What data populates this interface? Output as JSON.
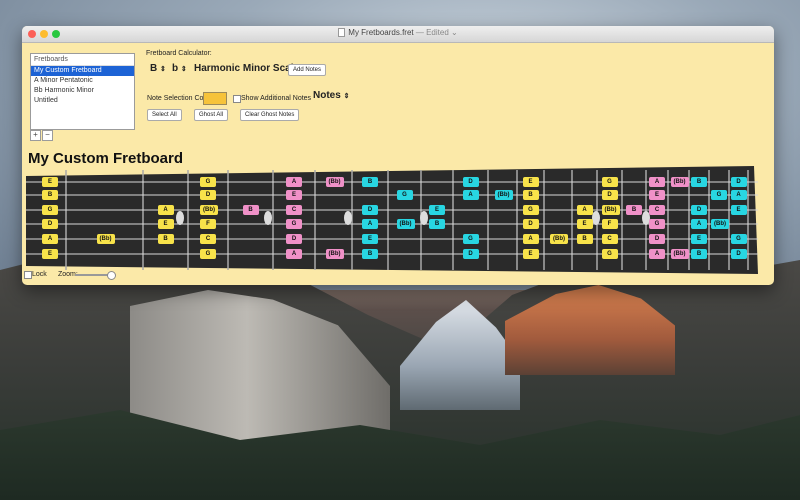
{
  "window": {
    "title": "My Fretboards.fret",
    "edited_label": "— Edited ⌄"
  },
  "sidebar": {
    "header": "Fretboards",
    "items": [
      "My Custom Fretboard",
      "A Minor Pentatonic",
      "Bb Harmonic Minor",
      "Untitled"
    ],
    "add_label": "+",
    "remove_label": "−"
  },
  "calculator": {
    "label": "Fretboard Calculator:",
    "root_note": "B",
    "accidental": "b",
    "scale": "Harmonic Minor Scale",
    "add_notes_label": "Add Notes",
    "note_selection_color_label": "Note Selection Color:",
    "note_selection_color": "#f6c33a",
    "show_additional_label": "Show Additional Notes",
    "notes_menu_label": "Notes",
    "select_all_label": "Select All",
    "ghost_all_label": "Ghost All",
    "clear_ghost_label": "Clear Ghost Notes"
  },
  "fretboard": {
    "title": "My Custom Fretboard",
    "lock_label": "Lock",
    "zoom_label": "Zoom:",
    "colors": {
      "yellow": "#f8e34a",
      "pink": "#f091c8",
      "cyan": "#28d6e2"
    },
    "notes": [
      {
        "label": "E",
        "color": "yellow",
        "fret": 0,
        "string": 0
      },
      {
        "label": "B",
        "color": "yellow",
        "fret": 0,
        "string": 1
      },
      {
        "label": "G",
        "color": "yellow",
        "fret": 0,
        "string": 2
      },
      {
        "label": "D",
        "color": "yellow",
        "fret": 0,
        "string": 3
      },
      {
        "label": "A",
        "color": "yellow",
        "fret": 0,
        "string": 4
      },
      {
        "label": "E",
        "color": "yellow",
        "fret": 0,
        "string": 5
      },
      {
        "label": "(Bb)",
        "color": "yellow",
        "fret": 1,
        "string": 4
      },
      {
        "label": "A",
        "color": "yellow",
        "fret": 2,
        "string": 2
      },
      {
        "label": "E",
        "color": "yellow",
        "fret": 2,
        "string": 3
      },
      {
        "label": "B",
        "color": "yellow",
        "fret": 2,
        "string": 4
      },
      {
        "label": "G",
        "color": "yellow",
        "fret": 3,
        "string": 0
      },
      {
        "label": "D",
        "color": "yellow",
        "fret": 3,
        "string": 1
      },
      {
        "label": "(Bb)",
        "color": "yellow",
        "fret": 3,
        "string": 2
      },
      {
        "label": "F",
        "color": "yellow",
        "fret": 3,
        "string": 3
      },
      {
        "label": "C",
        "color": "yellow",
        "fret": 3,
        "string": 4
      },
      {
        "label": "G",
        "color": "yellow",
        "fret": 3,
        "string": 5
      },
      {
        "label": "B",
        "color": "pink",
        "fret": 4,
        "string": 2
      },
      {
        "label": "A",
        "color": "pink",
        "fret": 5,
        "string": 0
      },
      {
        "label": "E",
        "color": "pink",
        "fret": 5,
        "string": 1
      },
      {
        "label": "C",
        "color": "pink",
        "fret": 5,
        "string": 2
      },
      {
        "label": "G",
        "color": "pink",
        "fret": 5,
        "string": 3
      },
      {
        "label": "D",
        "color": "pink",
        "fret": 5,
        "string": 4
      },
      {
        "label": "A",
        "color": "pink",
        "fret": 5,
        "string": 5
      },
      {
        "label": "(Bb)",
        "color": "pink",
        "fret": 6,
        "string": 0
      },
      {
        "label": "(Bb)",
        "color": "pink",
        "fret": 6,
        "string": 5
      },
      {
        "label": "B",
        "color": "cyan",
        "fret": 7,
        "string": 0
      },
      {
        "label": "D",
        "color": "cyan",
        "fret": 7,
        "string": 2
      },
      {
        "label": "A",
        "color": "cyan",
        "fret": 7,
        "string": 3
      },
      {
        "label": "E",
        "color": "cyan",
        "fret": 7,
        "string": 4
      },
      {
        "label": "B",
        "color": "cyan",
        "fret": 7,
        "string": 5
      },
      {
        "label": "G",
        "color": "cyan",
        "fret": 8,
        "string": 1
      },
      {
        "label": "(Bb)",
        "color": "cyan",
        "fret": 8,
        "string": 3
      },
      {
        "label": "E",
        "color": "cyan",
        "fret": 9,
        "string": 2
      },
      {
        "label": "B",
        "color": "cyan",
        "fret": 9,
        "string": 3
      },
      {
        "label": "D",
        "color": "cyan",
        "fret": 10,
        "string": 0
      },
      {
        "label": "A",
        "color": "cyan",
        "fret": 10,
        "string": 1
      },
      {
        "label": "G",
        "color": "cyan",
        "fret": 10,
        "string": 4
      },
      {
        "label": "D",
        "color": "cyan",
        "fret": 10,
        "string": 5
      },
      {
        "label": "(Bb)",
        "color": "cyan",
        "fret": 11,
        "string": 1
      },
      {
        "label": "E",
        "color": "yellow",
        "fret": 12,
        "string": 0
      },
      {
        "label": "B",
        "color": "yellow",
        "fret": 12,
        "string": 1
      },
      {
        "label": "G",
        "color": "yellow",
        "fret": 12,
        "string": 2
      },
      {
        "label": "D",
        "color": "yellow",
        "fret": 12,
        "string": 3
      },
      {
        "label": "A",
        "color": "yellow",
        "fret": 12,
        "string": 4
      },
      {
        "label": "E",
        "color": "yellow",
        "fret": 12,
        "string": 5
      },
      {
        "label": "(Bb)",
        "color": "yellow",
        "fret": 13,
        "string": 4
      },
      {
        "label": "A",
        "color": "yellow",
        "fret": 14,
        "string": 2
      },
      {
        "label": "E",
        "color": "yellow",
        "fret": 14,
        "string": 3
      },
      {
        "label": "B",
        "color": "yellow",
        "fret": 14,
        "string": 4
      },
      {
        "label": "G",
        "color": "yellow",
        "fret": 15,
        "string": 0
      },
      {
        "label": "D",
        "color": "yellow",
        "fret": 15,
        "string": 1
      },
      {
        "label": "(Bb)",
        "color": "yellow",
        "fret": 15,
        "string": 2
      },
      {
        "label": "F",
        "color": "yellow",
        "fret": 15,
        "string": 3
      },
      {
        "label": "C",
        "color": "yellow",
        "fret": 15,
        "string": 4
      },
      {
        "label": "G",
        "color": "yellow",
        "fret": 15,
        "string": 5
      },
      {
        "label": "B",
        "color": "pink",
        "fret": 16,
        "string": 2
      },
      {
        "label": "A",
        "color": "pink",
        "fret": 17,
        "string": 0
      },
      {
        "label": "E",
        "color": "pink",
        "fret": 17,
        "string": 1
      },
      {
        "label": "C",
        "color": "pink",
        "fret": 17,
        "string": 2
      },
      {
        "label": "G",
        "color": "pink",
        "fret": 17,
        "string": 3
      },
      {
        "label": "D",
        "color": "pink",
        "fret": 17,
        "string": 4
      },
      {
        "label": "A",
        "color": "pink",
        "fret": 17,
        "string": 5
      },
      {
        "label": "(Bb)",
        "color": "pink",
        "fret": 18,
        "string": 0
      },
      {
        "label": "(Bb)",
        "color": "pink",
        "fret": 18,
        "string": 5
      },
      {
        "label": "B",
        "color": "cyan",
        "fret": 19,
        "string": 0
      },
      {
        "label": "D",
        "color": "cyan",
        "fret": 19,
        "string": 2
      },
      {
        "label": "A",
        "color": "cyan",
        "fret": 19,
        "string": 3
      },
      {
        "label": "E",
        "color": "cyan",
        "fret": 19,
        "string": 4
      },
      {
        "label": "B",
        "color": "cyan",
        "fret": 19,
        "string": 5
      },
      {
        "label": "G",
        "color": "cyan",
        "fret": 20,
        "string": 1
      },
      {
        "label": "(Bb)",
        "color": "cyan",
        "fret": 20,
        "string": 3
      },
      {
        "label": "D",
        "color": "cyan",
        "fret": 21,
        "string": 0
      },
      {
        "label": "A",
        "color": "cyan",
        "fret": 21,
        "string": 1
      },
      {
        "label": "E",
        "color": "cyan",
        "fret": 21,
        "string": 2
      },
      {
        "label": "G",
        "color": "cyan",
        "fret": 21,
        "string": 4
      },
      {
        "label": "D",
        "color": "cyan",
        "fret": 21,
        "string": 5
      }
    ]
  }
}
